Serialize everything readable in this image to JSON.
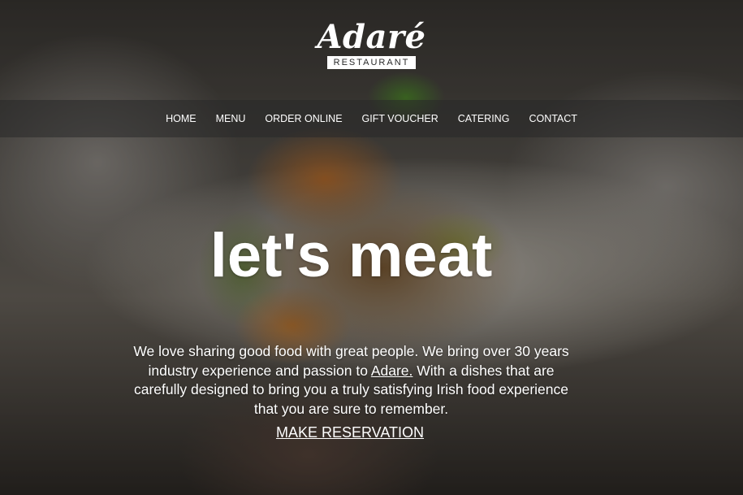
{
  "brand": {
    "name": "Adaré",
    "tagline": "RESTAURANT"
  },
  "nav": {
    "items": [
      {
        "label": "HOME"
      },
      {
        "label": "MENU"
      },
      {
        "label": "ORDER ONLINE"
      },
      {
        "label": "GIFT VOUCHER"
      },
      {
        "label": "CATERING"
      },
      {
        "label": "CONTACT"
      }
    ]
  },
  "hero": {
    "headline": "let's meat",
    "intro_before_link": "We love sharing good food with great people. We bring over 30 years industry experience and passion to ",
    "intro_link": "Adare.",
    "intro_after_link": " With a dishes that are carefully designed to bring you a truly satisfying Irish food experience that you are sure to remember.",
    "cta_label": "MAKE RESERVATION"
  },
  "colors": {
    "text": "#ffffff",
    "nav_bar": "rgba(40,40,40,0.55)"
  }
}
